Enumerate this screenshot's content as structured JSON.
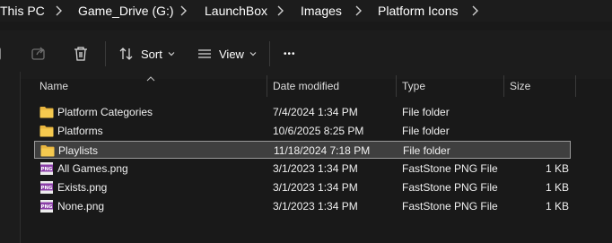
{
  "breadcrumb": [
    "This PC",
    "Game_Drive (G:)",
    "LaunchBox",
    "Images",
    "Platform Icons"
  ],
  "toolbar": {
    "sort_label": "Sort",
    "view_label": "View",
    "more_label": "•••"
  },
  "columns": {
    "name": "Name",
    "date": "Date modified",
    "type": "Type",
    "size": "Size"
  },
  "files": [
    {
      "name": "Platform Categories",
      "date": "7/4/2024 1:34 PM",
      "type": "File folder",
      "size": "",
      "icon": "folder-icon",
      "selected": false
    },
    {
      "name": "Platforms",
      "date": "10/6/2025 8:25 PM",
      "type": "File folder",
      "size": "",
      "icon": "folder-icon",
      "selected": false
    },
    {
      "name": "Playlists",
      "date": "11/18/2024 7:18 PM",
      "type": "File folder",
      "size": "",
      "icon": "folder-icon",
      "selected": true
    },
    {
      "name": "All Games.png",
      "date": "3/1/2023 1:34 PM",
      "type": "FastStone PNG File",
      "size": "1 KB",
      "icon": "png-file-icon",
      "selected": false
    },
    {
      "name": "Exists.png",
      "date": "3/1/2023 1:34 PM",
      "type": "FastStone PNG File",
      "size": "1 KB",
      "icon": "png-file-icon",
      "selected": false
    },
    {
      "name": "None.png",
      "date": "3/1/2023 1:34 PM",
      "type": "FastStone PNG File",
      "size": "1 KB",
      "icon": "png-file-icon",
      "selected": false
    }
  ],
  "colors": {
    "background": "#191919",
    "folder": "#f0c048",
    "png_icon": "#8b3fa8",
    "selection": "#3f3f3f"
  }
}
